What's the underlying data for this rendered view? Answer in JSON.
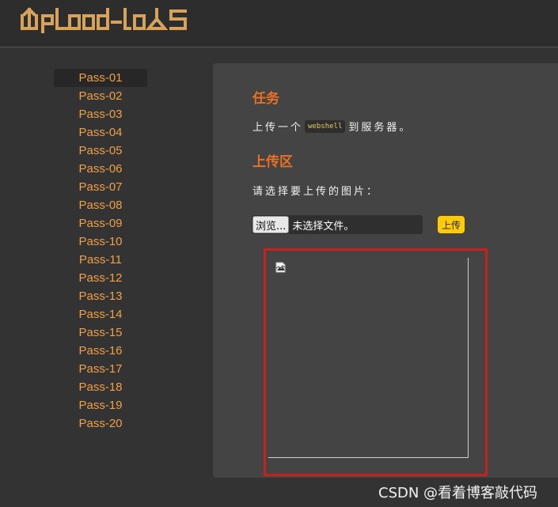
{
  "header": {
    "logo_text": "UpLoad-labS"
  },
  "sidebar": {
    "items": [
      "Pass-01",
      "Pass-02",
      "Pass-03",
      "Pass-04",
      "Pass-05",
      "Pass-06",
      "Pass-07",
      "Pass-08",
      "Pass-09",
      "Pass-10",
      "Pass-11",
      "Pass-12",
      "Pass-13",
      "Pass-14",
      "Pass-15",
      "Pass-16",
      "Pass-17",
      "Pass-18",
      "Pass-19",
      "Pass-20"
    ],
    "active_index": 0
  },
  "task": {
    "heading": "任务",
    "text_before": "上传一个",
    "code": "webshell",
    "text_after": "到服务器。"
  },
  "upload": {
    "heading": "上传区",
    "prompt": "请选择要上传的图片：",
    "browse_label": "浏览...",
    "file_status": "未选择文件。",
    "submit_label": "上传"
  },
  "preview": {
    "icon": "broken-image-icon"
  },
  "watermark": "CSDN @看着博客敲代码",
  "colors": {
    "accent": "#e97024",
    "link": "#f0a046",
    "button": "#ffcc00",
    "highlight_frame": "#c8201e"
  }
}
